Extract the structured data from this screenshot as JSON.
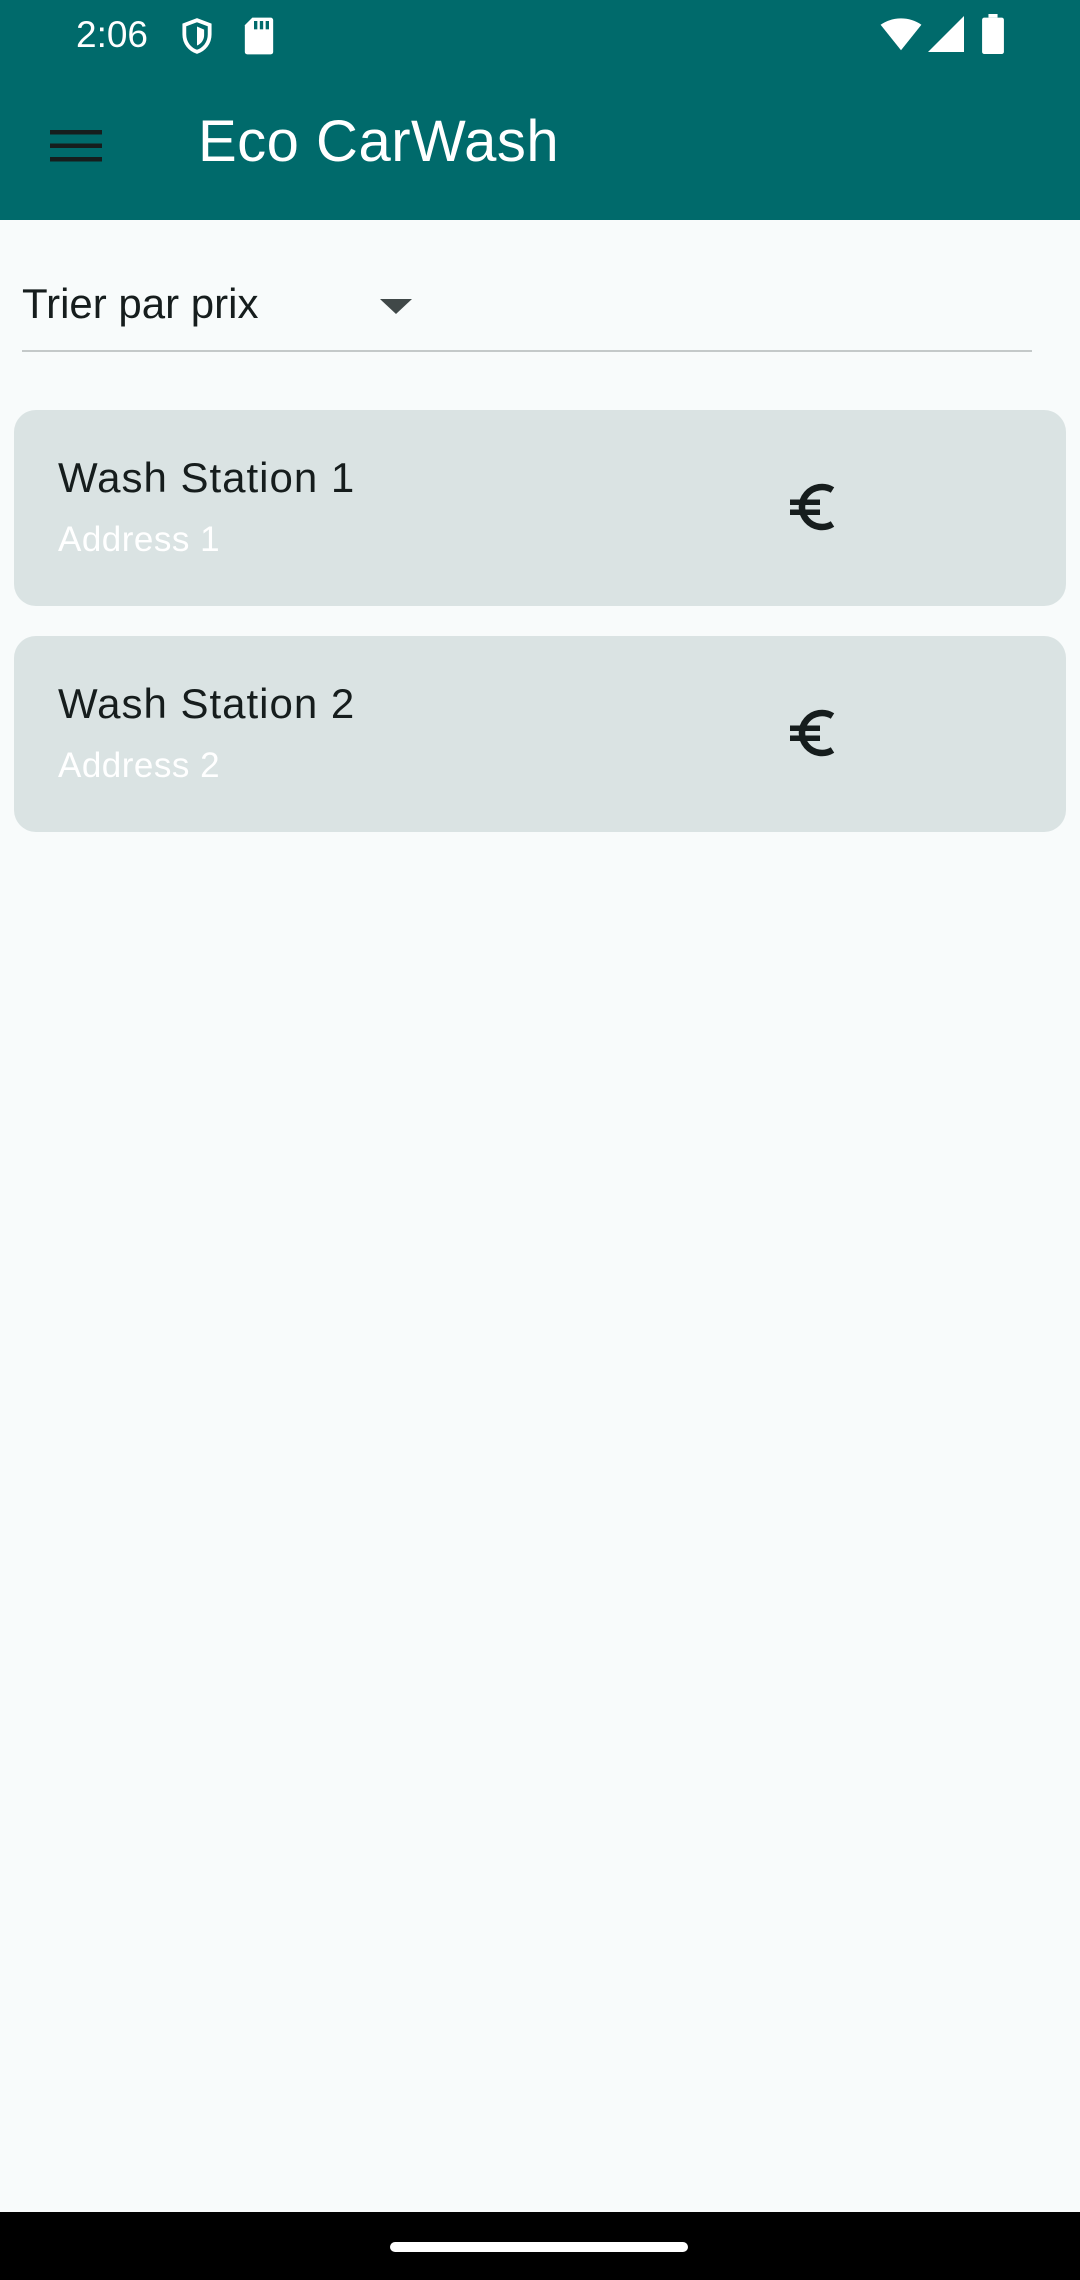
{
  "status_bar": {
    "time": "2:06",
    "icons": [
      "shield-icon",
      "sd-card-icon",
      "wifi-icon",
      "signal-icon",
      "battery-icon"
    ]
  },
  "app_bar": {
    "title": "Eco CarWash",
    "menu_icon": "hamburger-menu-icon",
    "background_color": "#006a6b"
  },
  "sort": {
    "selected_label": "Trier par prix",
    "arrow_icon": "dropdown-arrow-icon"
  },
  "stations": [
    {
      "name": "Wash Station 1",
      "address": "Address 1",
      "icon": "euro-icon"
    },
    {
      "name": "Wash Station 2",
      "address": "Address 2",
      "icon": "euro-icon"
    }
  ],
  "colors": {
    "primary": "#006a6b",
    "card_background": "#dae3e3",
    "page_background": "#f8fbfb"
  }
}
